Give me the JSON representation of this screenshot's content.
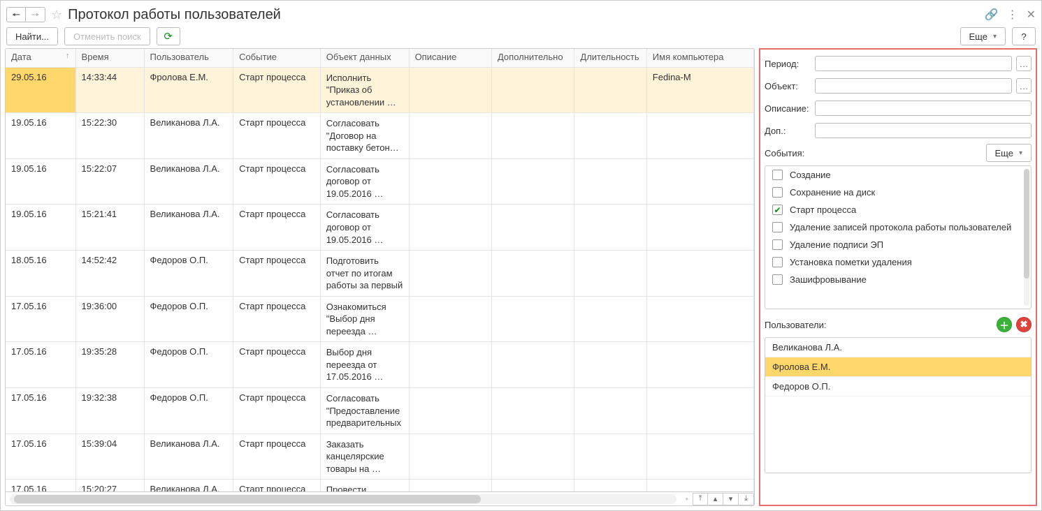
{
  "header": {
    "title": "Протокол работы пользователей"
  },
  "toolbar": {
    "find": "Найти...",
    "cancel_find": "Отменить поиск",
    "more": "Еще",
    "help": "?"
  },
  "columns": {
    "date": "Дата",
    "time": "Время",
    "user": "Пользователь",
    "event": "Событие",
    "object": "Объект данных",
    "descr": "Описание",
    "add": "Дополнительно",
    "dur": "Длительность",
    "comp": "Имя компьютера"
  },
  "rows": [
    {
      "date": "29.05.16",
      "time": "14:33:44",
      "user": "Фролова Е.М.",
      "event": "Старт процесса",
      "obj": "Исполнить \"Приказ об установлении …",
      "comp": "Fedina-M",
      "sel": true
    },
    {
      "date": "19.05.16",
      "time": "15:22:30",
      "user": "Великанова Л.А.",
      "event": "Старт процесса",
      "obj": "Согласовать \"Договор на поставку бетон…",
      "comp": ""
    },
    {
      "date": "19.05.16",
      "time": "15:22:07",
      "user": "Великанова Л.А.",
      "event": "Старт процесса",
      "obj": "Согласовать договор от 19.05.2016 …",
      "comp": ""
    },
    {
      "date": "19.05.16",
      "time": "15:21:41",
      "user": "Великанова Л.А.",
      "event": "Старт процесса",
      "obj": "Согласовать договор от 19.05.2016 …",
      "comp": ""
    },
    {
      "date": "18.05.16",
      "time": "14:52:42",
      "user": "Федоров О.П.",
      "event": "Старт процесса",
      "obj": "Подготовить отчет по итогам работы за первый",
      "comp": ""
    },
    {
      "date": "17.05.16",
      "time": "19:36:00",
      "user": "Федоров О.П.",
      "event": "Старт процесса",
      "obj": "Ознакомиться \"Выбор дня переезда …",
      "comp": ""
    },
    {
      "date": "17.05.16",
      "time": "19:35:28",
      "user": "Федоров О.П.",
      "event": "Старт процесса",
      "obj": "Выбор дня переезда от 17.05.2016 …",
      "comp": ""
    },
    {
      "date": "17.05.16",
      "time": "19:32:38",
      "user": "Федоров О.П.",
      "event": "Старт процесса",
      "obj": "Согласовать \"Предоставление предварительных",
      "comp": ""
    },
    {
      "date": "17.05.16",
      "time": "15:39:04",
      "user": "Великанова Л.А.",
      "event": "Старт процесса",
      "obj": "Заказать канцелярские товары на …",
      "comp": ""
    },
    {
      "date": "17.05.16",
      "time": "15:20:27",
      "user": "Великанова Л.А.",
      "event": "Старт процесса",
      "obj": "Провести коррупционный",
      "comp": ""
    }
  ],
  "filters": {
    "period_label": "Период:",
    "object_label": "Объект:",
    "descr_label": "Описание:",
    "add_label": "Доп.:",
    "events_label": "События:",
    "users_label": "Пользователи:",
    "more": "Еще",
    "period_value": "",
    "object_value": "",
    "descr_value": "",
    "add_value": ""
  },
  "event_types": [
    {
      "label": "Создание",
      "checked": false
    },
    {
      "label": "Сохранение на диск",
      "checked": false
    },
    {
      "label": "Старт процесса",
      "checked": true
    },
    {
      "label": "Удаление записей протокола работы пользователей",
      "checked": false
    },
    {
      "label": "Удаление подписи ЭП",
      "checked": false
    },
    {
      "label": "Установка пометки удаления",
      "checked": false
    },
    {
      "label": "Зашифровывание",
      "checked": false
    }
  ],
  "users": [
    {
      "name": "Великанова Л.А.",
      "sel": false
    },
    {
      "name": "Фролова Е.М.",
      "sel": true
    },
    {
      "name": "Федоров О.П.",
      "sel": false
    }
  ]
}
